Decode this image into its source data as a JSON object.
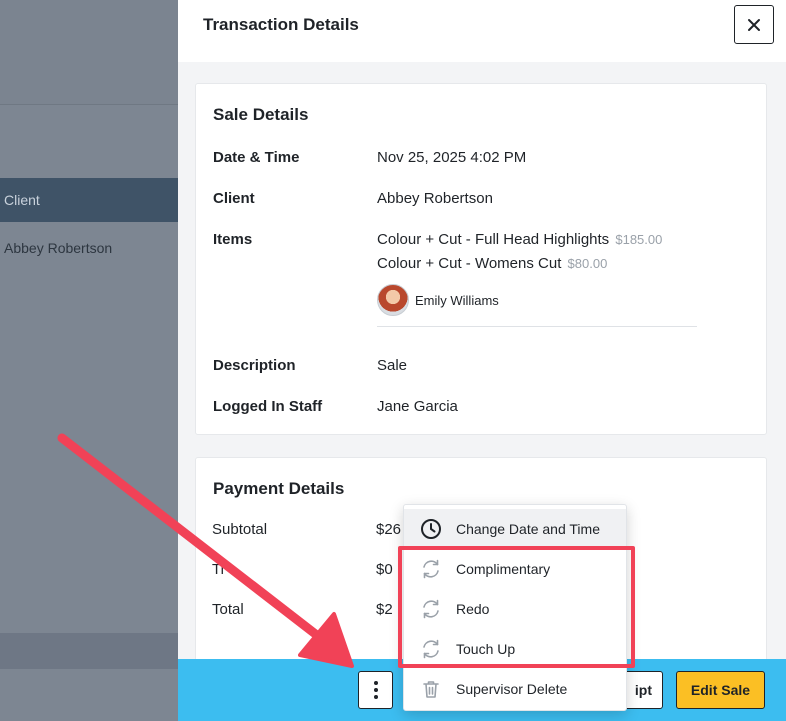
{
  "background": {
    "header_label": "Client",
    "row_client": "Abbey Robertson"
  },
  "drawer": {
    "title": "Transaction Details",
    "close_icon": "close-icon"
  },
  "sale_details": {
    "title": "Sale Details",
    "rows": [
      {
        "label": "Date & Time",
        "value": "Nov 25, 2025 4:02 PM"
      },
      {
        "label": "Client",
        "value": "Abbey Robertson"
      },
      {
        "label": "Items",
        "value": ""
      },
      {
        "label": "Description",
        "value": "Sale"
      },
      {
        "label": "Logged In Staff",
        "value": "Jane Garcia"
      }
    ],
    "items": [
      {
        "name": "Colour + Cut - Full Head Highlights",
        "price": "$185.00"
      },
      {
        "name": "Colour + Cut - Womens Cut",
        "price": "$80.00"
      }
    ],
    "staff_name": "Emily Williams"
  },
  "payment_details": {
    "title": "Payment Details",
    "rows": [
      {
        "label": "Subtotal",
        "value": "$26"
      },
      {
        "label": "Ti",
        "value": "$0"
      },
      {
        "label": "Total",
        "value": "$2"
      }
    ]
  },
  "footer": {
    "more_icon": "more-vertical-icon",
    "receipt_label": "ipt",
    "edit_label": "Edit Sale"
  },
  "menu": {
    "items": [
      {
        "label": "Change Date and Time",
        "icon": "clock-icon"
      },
      {
        "label": "Complimentary",
        "icon": "refresh-icon"
      },
      {
        "label": "Redo",
        "icon": "refresh-icon"
      },
      {
        "label": "Touch Up",
        "icon": "refresh-icon"
      },
      {
        "label": "Supervisor Delete",
        "icon": "trash-icon"
      }
    ]
  },
  "colors": {
    "footer_bar": "#3cbdf0",
    "edit_button": "#fbbf24",
    "annotation": "#f14257"
  }
}
